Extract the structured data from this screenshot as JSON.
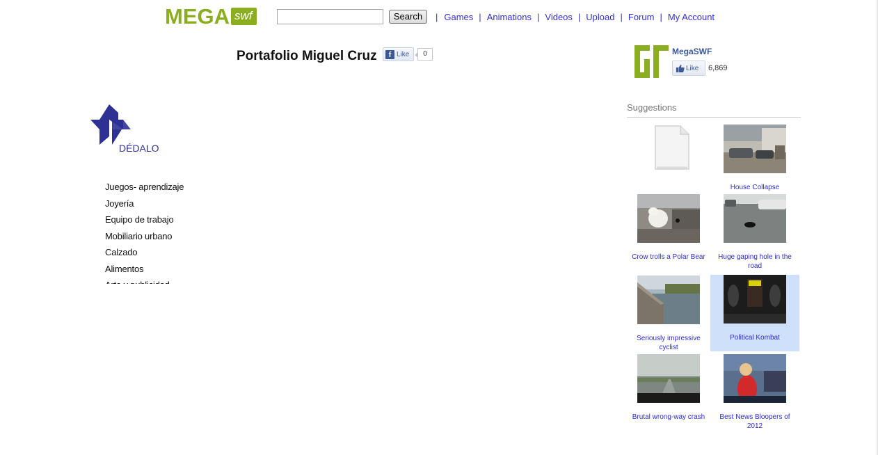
{
  "header": {
    "logo_main": "MEGA",
    "logo_sub": "swf",
    "search_value": "",
    "search_button": "Search",
    "nav": [
      "Games",
      "Animations",
      "Videos",
      "Upload",
      "Forum",
      "My Account"
    ]
  },
  "title": {
    "text": "Portafolio Miguel Cruz",
    "like_label": "Like",
    "like_count": "0"
  },
  "embed": {
    "brand": "DÉDALO",
    "menu": [
      "Juegos- aprendizaje",
      "Joyería",
      "Equipo de trabajo",
      "Mobiliario urbano",
      "Calzado",
      "Alimentos",
      "Arte y publicidad"
    ]
  },
  "facebook_box": {
    "page_name": "MegaSWF",
    "like_label": "Like",
    "like_count": "6,869"
  },
  "suggestions": {
    "title": "Suggestions",
    "items": [
      {
        "caption": "",
        "thumb": "file-placeholder-icon"
      },
      {
        "caption": "House Collapse",
        "thumb": "house-collapse"
      },
      {
        "caption": "Crow trolls a Polar Bear",
        "thumb": "polar-bear"
      },
      {
        "caption": "Huge gaping hole in the road",
        "thumb": "road-hole"
      },
      {
        "caption": "Seriously impressive cyclist",
        "thumb": "cyclist"
      },
      {
        "caption": "Political Kombat",
        "thumb": "political-kombat"
      },
      {
        "caption": "Brutal wrong-way crash",
        "thumb": "wrong-way-crash"
      },
      {
        "caption": "Best News Bloopers of 2012",
        "thumb": "news-bloopers"
      }
    ]
  },
  "colors": {
    "brand_green": "#8aae1f",
    "link_blue": "#3330cc",
    "facebook_blue": "#3b5998",
    "dedalo_blue": "#2e3192",
    "highlight": "#cfe0fb"
  }
}
